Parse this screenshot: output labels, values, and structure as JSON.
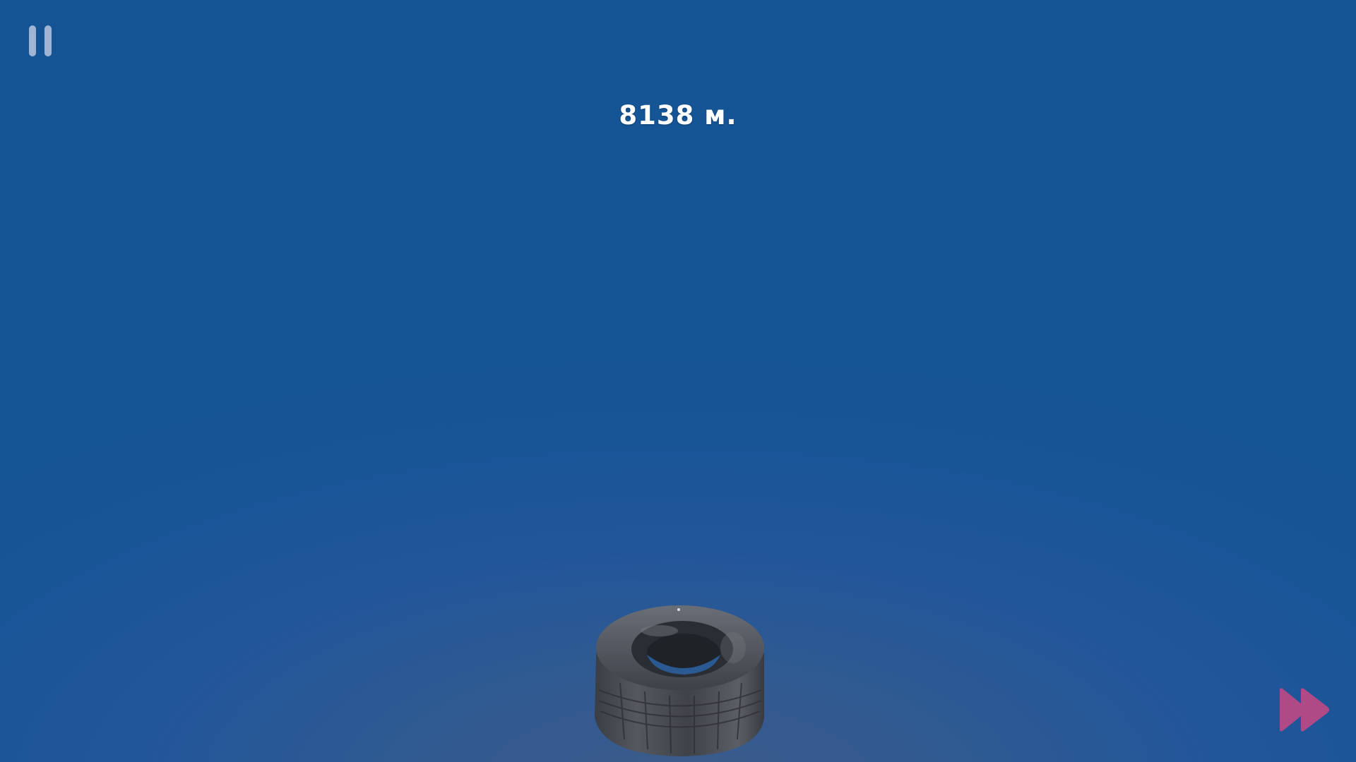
{
  "hud": {
    "distance_text": "8138 м."
  },
  "icons": {
    "pause": "pause-icon",
    "fast_forward": "fast-forward-icon",
    "player": "tire-icon"
  },
  "colors": {
    "sky_top": "#155495",
    "sky_bottom": "#3d5b8a",
    "hud_text": "#ffffff",
    "pause_icon": "#b9c6de",
    "fast_forward_icon": "#b04a86"
  }
}
